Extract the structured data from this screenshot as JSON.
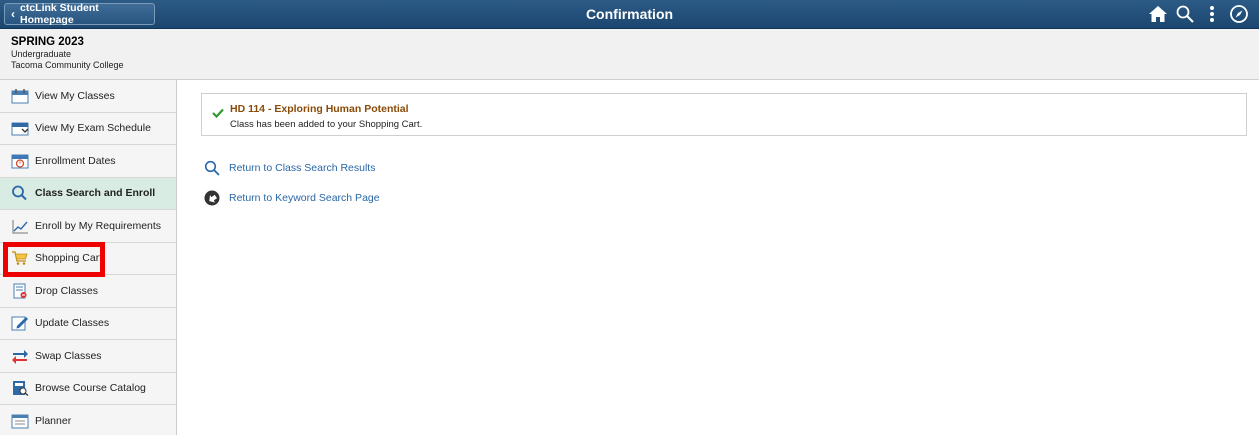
{
  "header": {
    "back_label": "ctcLink Student Homepage",
    "title": "Confirmation",
    "icons": [
      "home-icon",
      "search-icon",
      "actions-menu-icon",
      "navbar-icon"
    ]
  },
  "context": {
    "term": "SPRING 2023",
    "career": "Undergraduate",
    "institution": "Tacoma Community College"
  },
  "sidebar": {
    "items": [
      {
        "label": "View My Classes",
        "icon": "calendar-icon"
      },
      {
        "label": "View My Exam Schedule",
        "icon": "exam-calendar-icon"
      },
      {
        "label": "Enrollment Dates",
        "icon": "enrollment-dates-icon"
      },
      {
        "label": "Class Search and Enroll",
        "icon": "search-icon",
        "selected": true
      },
      {
        "label": "Enroll by My Requirements",
        "icon": "chart-line-icon"
      },
      {
        "label": "Shopping Cart",
        "icon": "shopping-cart-icon",
        "highlighted": true
      },
      {
        "label": "Drop Classes",
        "icon": "drop-classes-icon"
      },
      {
        "label": "Update Classes",
        "icon": "edit-icon"
      },
      {
        "label": "Swap Classes",
        "icon": "swap-icon"
      },
      {
        "label": "Browse Course Catalog",
        "icon": "catalog-icon"
      },
      {
        "label": "Planner",
        "icon": "planner-icon"
      }
    ]
  },
  "message": {
    "title": "HD  114 - Exploring Human Potential",
    "text": "Class has been added to your Shopping Cart."
  },
  "links": {
    "return_class_search": "Return to Class Search Results",
    "return_keyword_search": "Return to Keyword Search Page"
  },
  "colors": {
    "banner": "#1f4a74",
    "selected_bg": "#d9ece3",
    "highlight": "#ee0000",
    "link": "#2a67a8",
    "message_title": "#8a4b08",
    "success": "#2f9a2f"
  }
}
